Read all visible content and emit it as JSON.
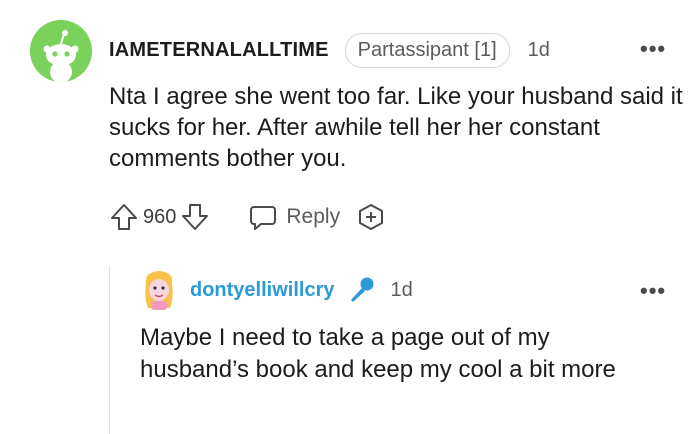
{
  "comment": {
    "username": "IAMETERNALALLTIME",
    "flair": "Partassipant [1]",
    "time": "1d",
    "body": "Nta I agree she went too far. Like your husband said it sucks for her. After awhile tell her her constant comments bother you.",
    "votes": "960",
    "reply_label": "Reply",
    "avatar_color": "#7ad25d",
    "icons": [
      "upvote-icon",
      "downvote-icon",
      "reply-icon",
      "award-icon",
      "more-icon"
    ]
  },
  "reply": {
    "username": "dontyelliwillcry",
    "time": "1d",
    "body": "Maybe I need to take a page out of my husband’s book and keep my cool a bit more",
    "username_color": "#2b9bd8",
    "icons": [
      "microphone-icon",
      "more-icon"
    ]
  }
}
